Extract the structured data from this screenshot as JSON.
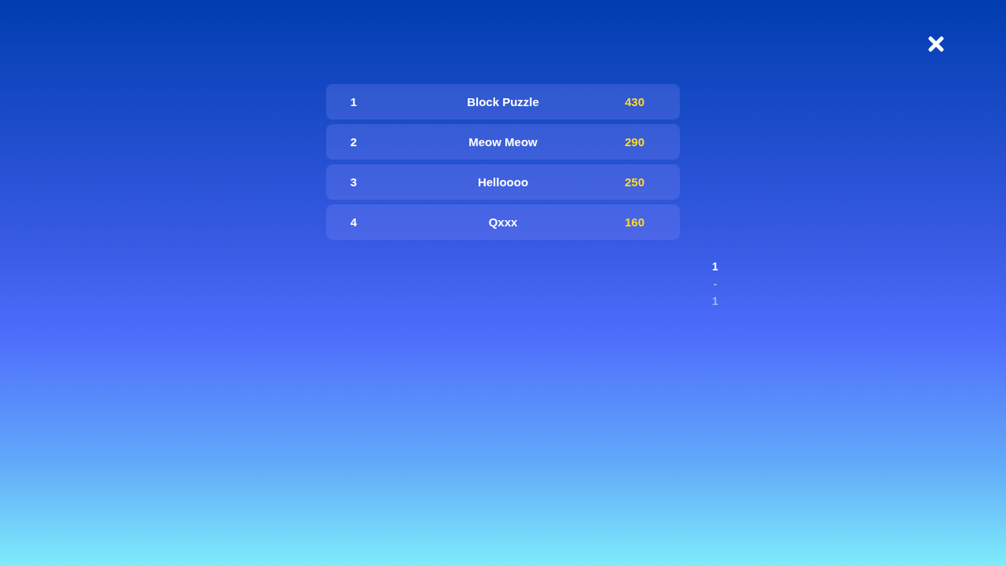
{
  "leaderboard": [
    {
      "rank": "1",
      "name": "Block Puzzle",
      "score": "430"
    },
    {
      "rank": "2",
      "name": "Meow Meow",
      "score": "290"
    },
    {
      "rank": "3",
      "name": "Helloooo",
      "score": "250"
    },
    {
      "rank": "4",
      "name": "Qxxx",
      "score": "160"
    }
  ],
  "pager": {
    "current": "1",
    "separator": "-",
    "total": "1"
  }
}
